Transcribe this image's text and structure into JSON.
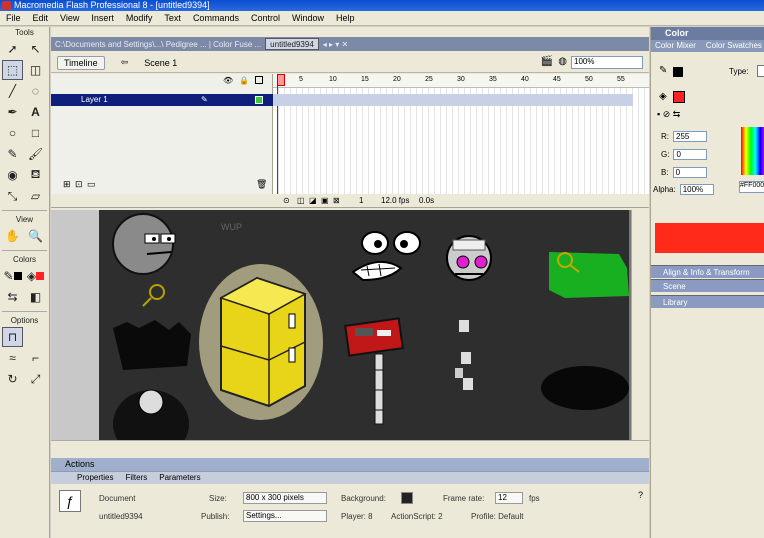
{
  "window": {
    "title": "Macromedia Flash Professional 8 - [untitled9394]"
  },
  "menu": [
    "File",
    "Edit",
    "View",
    "Insert",
    "Modify",
    "Text",
    "Commands",
    "Control",
    "Window",
    "Help"
  ],
  "tools_panel": {
    "tools_label": "Tools",
    "view_label": "View",
    "colors_label": "Colors",
    "options_label": "Options"
  },
  "doc_tabs": {
    "path": "C:\\Documents and Settings\\...\\ Pedigree ... | Color Fuse ...",
    "active": "untitled9394"
  },
  "timeline_header": {
    "timeline_button": "Timeline",
    "scene_label": "Scene 1",
    "zoom_value": "100%"
  },
  "timeline": {
    "layer_name": "Layer 1",
    "ruler": [
      "5",
      "10",
      "15",
      "20",
      "25",
      "30",
      "35",
      "40",
      "45",
      "50",
      "55"
    ],
    "current_frame": "1",
    "fps": "12.0 fps",
    "elapsed": "0.0s"
  },
  "panels": {
    "actions": "Actions",
    "props_tabs": [
      "Properties",
      "Filters",
      "Parameters"
    ],
    "doc_type": "Document",
    "doc_name": "untitled9394",
    "size_label": "Size:",
    "size_value": "800 x 300 pixels",
    "background_label": "Background:",
    "frame_rate_label": "Frame rate:",
    "frame_rate_value": "12",
    "fps_unit": "fps",
    "publish_label": "Publish:",
    "settings_button": "Settings...",
    "player_label": "Player: 8",
    "actionscript_label": "ActionScript: 2",
    "profile_label": "Profile: Default"
  },
  "color_panel": {
    "title": "Color",
    "tabs": [
      "Color Mixer",
      "Color Swatches"
    ],
    "type_label": "Type:",
    "r_label": "R:",
    "r_value": "255",
    "g_label": "G:",
    "g_value": "0",
    "b_label": "B:",
    "b_value": "0",
    "alpha_label": "Alpha:",
    "alpha_value": "100%",
    "hex_value": "#FF0000",
    "preview_color": "#ff2a1a"
  },
  "collapsed_panels": [
    "Align & Info & Transform",
    "Scene",
    "Library"
  ]
}
